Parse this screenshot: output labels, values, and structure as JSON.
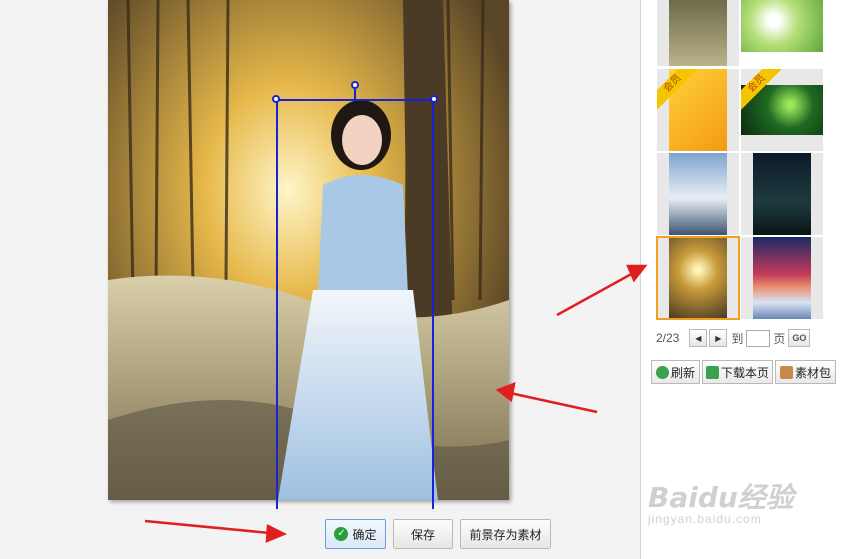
{
  "editor": {
    "confirm_label": "确定",
    "save_label": "保存",
    "save_foreground_label": "前景存为素材"
  },
  "gallery": {
    "vip_badge": "会员",
    "thumbnails": [
      "grass",
      "white-flowers",
      "yellow-vip",
      "green-bokeh-vip",
      "snow-mountain",
      "night-road",
      "snow-forest-sunset",
      "purple-sky-snow"
    ],
    "selected_index": 6
  },
  "pager": {
    "current": "2/23",
    "goto_label": "到",
    "page_label": "页",
    "go_label": "GO",
    "input_value": ""
  },
  "toolbar": {
    "refresh_label": "刷新",
    "download_label": "下载本页",
    "package_label": "素材包"
  },
  "watermark": {
    "logo": "Baidu经验",
    "url": "jingyan.baidu.com"
  },
  "colors": {
    "selection_box": "#1a22d8",
    "selected_thumb": "#f0a020",
    "annotation_arrow": "#e02020",
    "vip_badge": "#f5c400"
  }
}
